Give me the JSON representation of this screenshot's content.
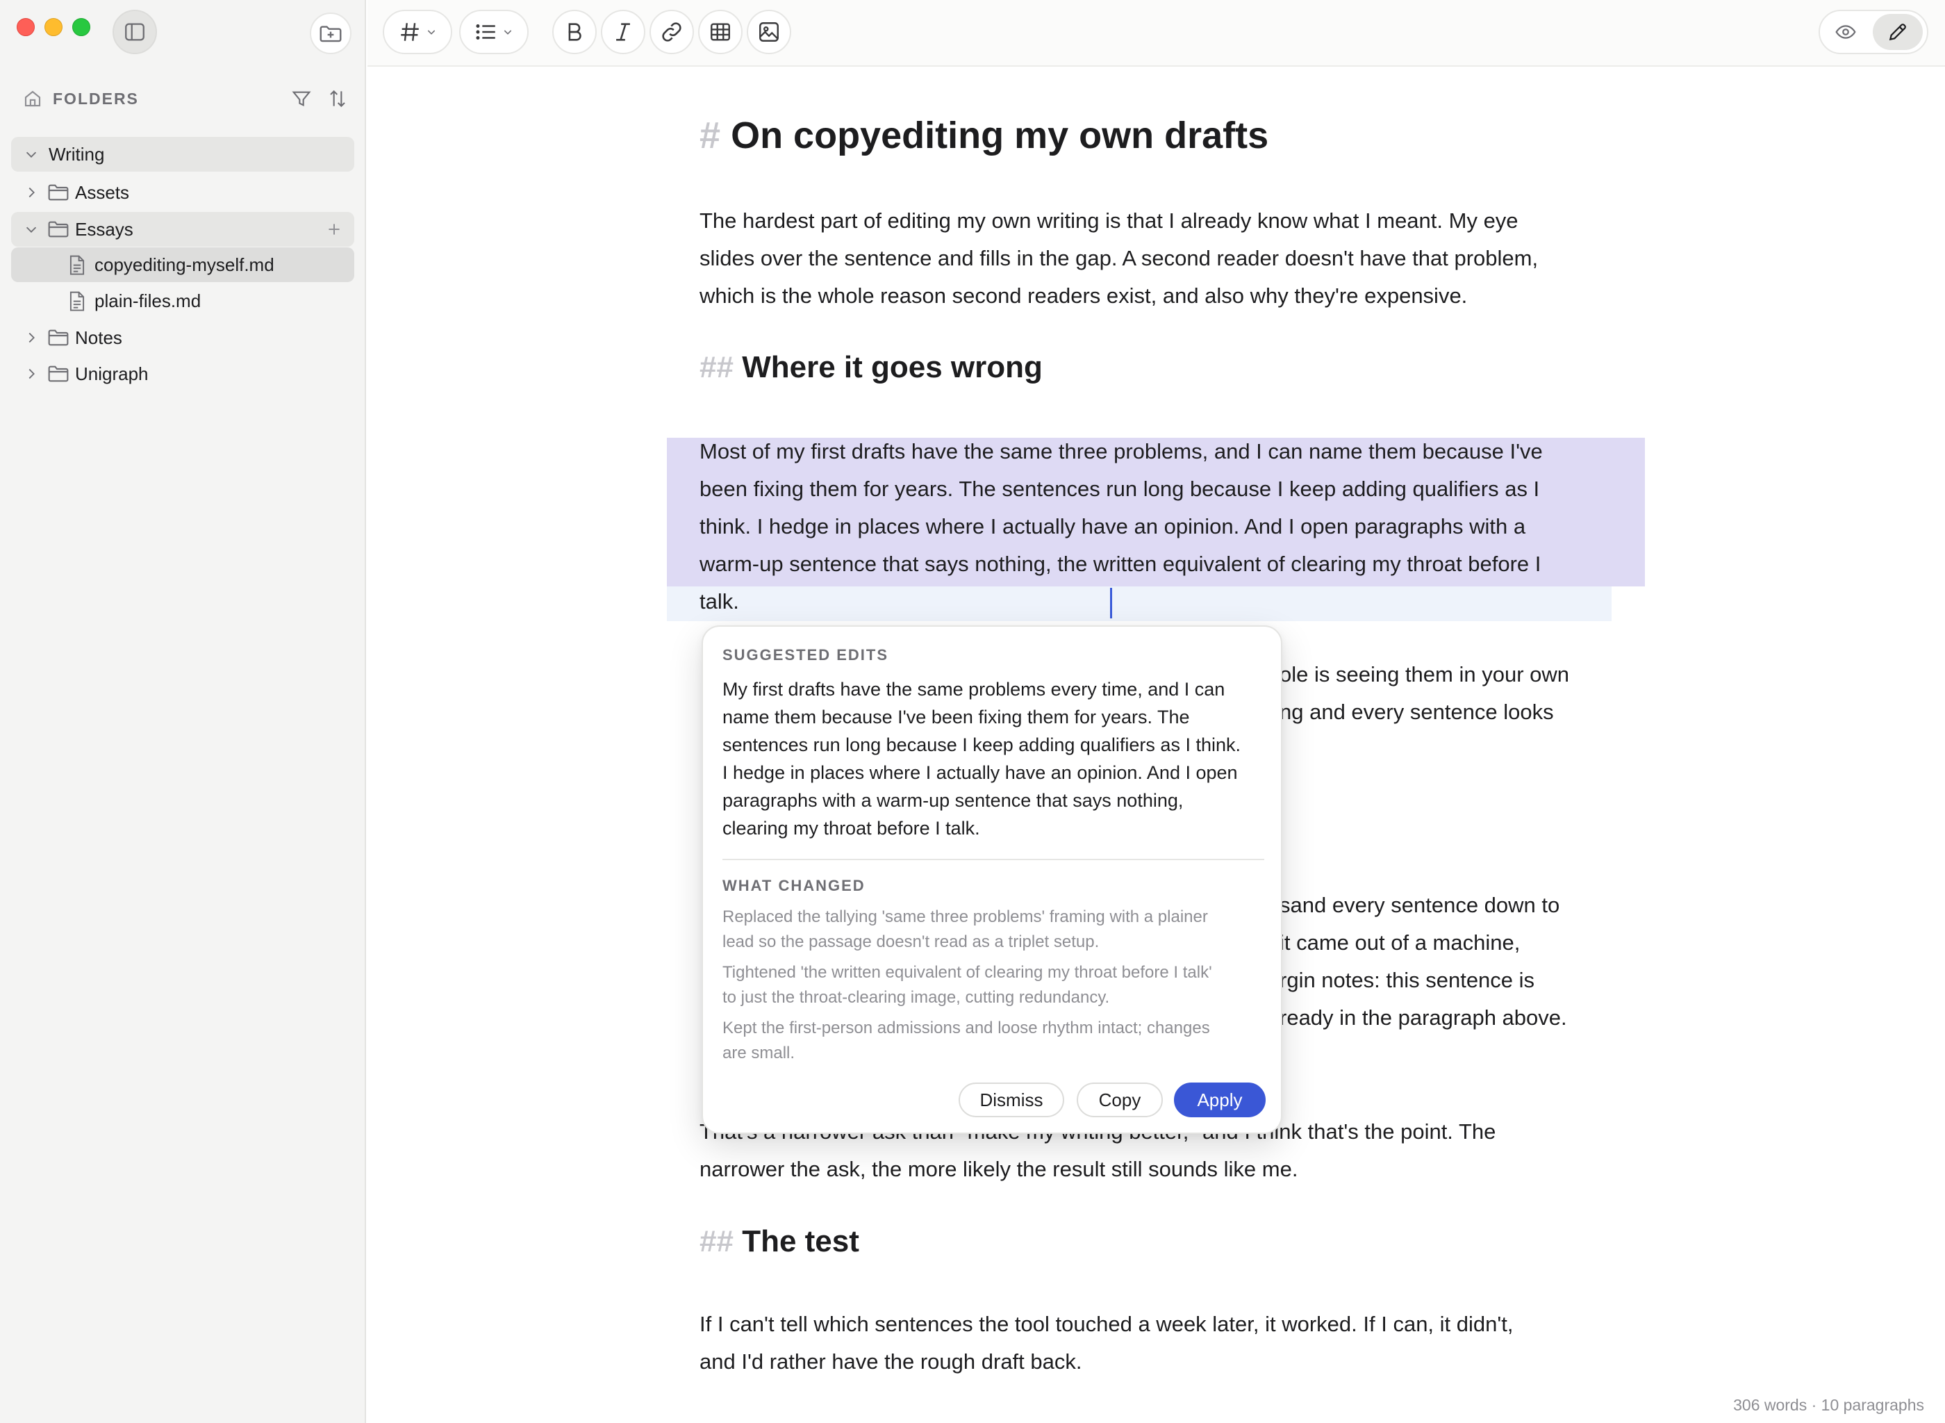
{
  "sidebar": {
    "header": "FOLDERS",
    "tree": [
      {
        "label": "Writing"
      },
      {
        "label": "Assets"
      },
      {
        "label": "Essays"
      },
      {
        "label": "copyediting-myself.md"
      },
      {
        "label": "plain-files.md"
      },
      {
        "label": "Notes"
      },
      {
        "label": "Unigraph"
      }
    ]
  },
  "toolbar": {
    "icons": [
      "heading-icon",
      "list-icon",
      "bold-icon",
      "italic-icon",
      "link-icon",
      "table-icon",
      "image-icon",
      "eye-icon",
      "pencil-icon"
    ]
  },
  "document": {
    "h1_mark": "#",
    "title": "On copyediting my own drafts",
    "p1": [
      "The hardest part of editing my own writing is that I already know what I meant. My eye",
      "slides over the sentence and fills in the gap. A second reader doesn't have that problem,",
      "which is the whole reason second readers exist, and also why they're expensive."
    ],
    "h2_mark": "##",
    "h2a": "Where it goes wrong",
    "p2": [
      "Most of my first drafts have the same three problems, and I can name them because I've",
      "been fixing them for years. The sentences run long because I keep adding qualifiers as I",
      "think. I hedge in places where I actually have an opinion. And I open paragraphs with a",
      "warm-up sentence that says nothing, the written equivalent of clearing my throat before I",
      "talk."
    ],
    "p3_partial": [
      "ole is seeing them in your own",
      "ng and every sentence looks"
    ],
    "p4_partial": [
      "sand every sentence down to",
      "it came out of a machine,",
      "rgin notes: this sentence is",
      "ready in the paragraph above."
    ],
    "p5_top_partial": "That's a narrower ask than \"make my writing better,\" and I think that's the point. The",
    "p5_line2": "narrower the ask, the more likely the result still sounds like me.",
    "h2b": "The test",
    "p6": [
      "If I can't tell which sentences the tool touched a week later, it worked. If I can, it didn't,",
      "and I'd rather have the rough draft back."
    ]
  },
  "popover": {
    "suggested_label": "SUGGESTED EDITS",
    "suggestion": [
      "My first drafts have the same problems every time, and I can",
      "name them because I've been fixing them for years. The",
      "sentences run long because I keep adding qualifiers as I think.",
      "I hedge in places where I actually have an opinion. And I open",
      "paragraphs with a warm-up sentence that says nothing,",
      "clearing my throat before I talk."
    ],
    "changed_label": "WHAT CHANGED",
    "changes": [
      [
        "Replaced the tallying 'same three problems' framing with a plainer",
        "lead so the passage doesn't read as a triplet setup."
      ],
      [
        "Tightened 'the written equivalent of clearing my throat before I talk'",
        "to just the throat-clearing image, cutting redundancy."
      ],
      [
        "Kept the first-person admissions and loose rhythm intact; changes",
        "are small."
      ]
    ],
    "dismiss": "Dismiss",
    "copy": "Copy",
    "apply": "Apply"
  },
  "status": "306 words · 10 paragraphs",
  "colors": {
    "accent": "#3a57d6",
    "selection": "#dcd8f3",
    "close": "#fe5f57",
    "minimize": "#febc2e",
    "maximize": "#28c840"
  }
}
